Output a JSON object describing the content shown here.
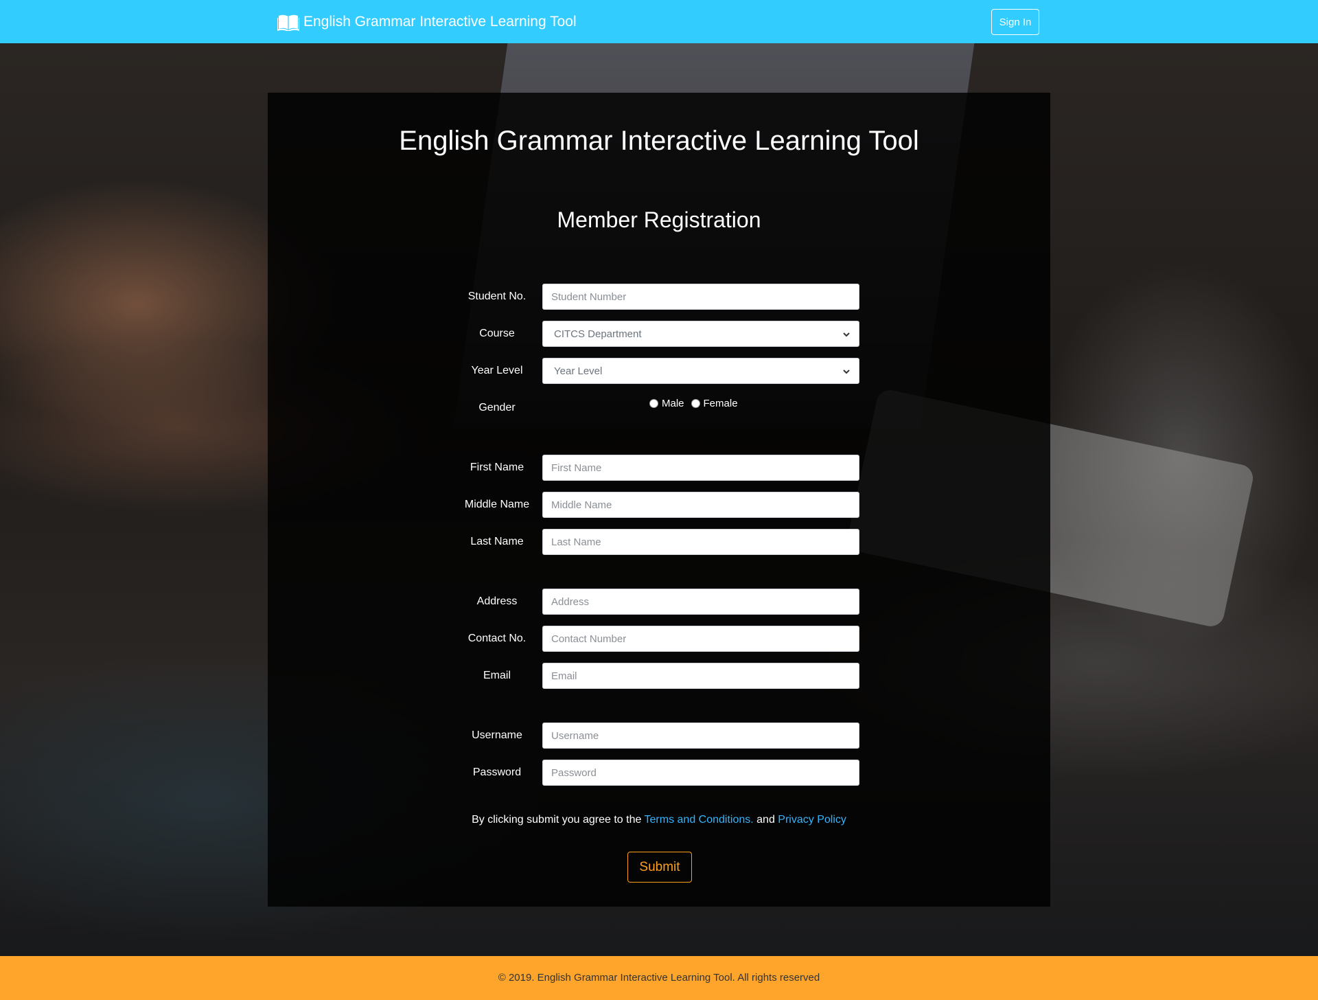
{
  "navbar": {
    "brand_label": "English Grammar Interactive Learning Tool",
    "brand_icon": "open-book-icon",
    "signin_label": "Sign In",
    "bg_color": "#33ccff"
  },
  "form": {
    "title": "English Grammar Interactive Learning Tool",
    "subtitle": "Member Registration",
    "student_no": {
      "label": "Student No.",
      "placeholder": "Student Number"
    },
    "course": {
      "label": "Course",
      "selected": "CITCS Department"
    },
    "year_level": {
      "label": "Year Level",
      "selected": "Year Level"
    },
    "gender": {
      "label": "Gender",
      "options": [
        "Male",
        "Female"
      ]
    },
    "first_name": {
      "label": "First Name",
      "placeholder": "First Name"
    },
    "middle_name": {
      "label": "Middle Name",
      "placeholder": "Middle Name"
    },
    "last_name": {
      "label": "Last Name",
      "placeholder": "Last Name"
    },
    "address": {
      "label": "Address",
      "placeholder": "Address"
    },
    "contact_no": {
      "label": "Contact No.",
      "placeholder": "Contact Number"
    },
    "email": {
      "label": "Email",
      "placeholder": "Email"
    },
    "username": {
      "label": "Username",
      "placeholder": "Username"
    },
    "password": {
      "label": "Password",
      "placeholder": "Password"
    },
    "terms": {
      "prefix": "By clicking submit you agree to the ",
      "terms_link": "Terms and Conditions.",
      "and": " and ",
      "privacy_link": "Privacy Policy"
    },
    "submit_label": "Submit",
    "link_color": "#33b5ff",
    "submit_color": "#ff9f1a"
  },
  "footer": {
    "text": "© 2019. English Grammar Interactive Learning Tool. All rights reserved",
    "bg_color": "#ffa52b"
  }
}
